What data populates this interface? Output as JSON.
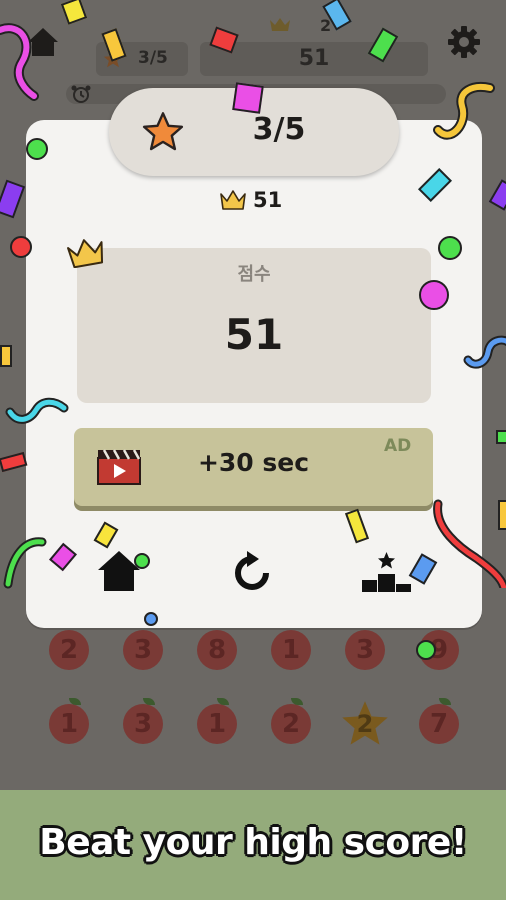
{
  "hud": {
    "stars": "3/5",
    "best_score": "2",
    "current_score": "51"
  },
  "dialog": {
    "stars": "3/5",
    "best_score": "51",
    "score_label": "점수",
    "score_value": "51",
    "ad_button": {
      "label": "+30 sec",
      "badge": "AD"
    },
    "actions": [
      "home",
      "restart",
      "leaderboard"
    ]
  },
  "board": {
    "row1": [
      "2",
      "3",
      "8",
      "1",
      "3",
      "9"
    ],
    "row2": [
      "1",
      "3",
      "1",
      "2",
      "2",
      "7"
    ]
  },
  "banner": {
    "text": "Beat your high score!"
  },
  "colors": {
    "dialog_bg": "#f4f3f1",
    "ad_button": "#c7c39a",
    "banner_bg": "#94ab7b",
    "star": "#f08a3a",
    "crown": "#f3c64a",
    "apple": "#7a3a36"
  }
}
